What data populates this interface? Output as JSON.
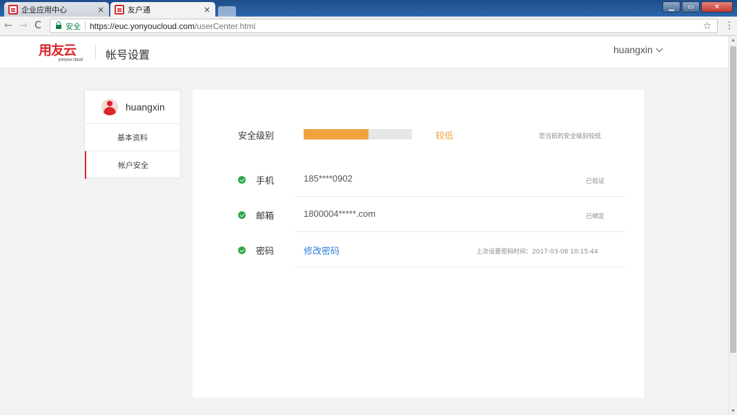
{
  "browser": {
    "tabs": [
      {
        "title": "企业应用中心",
        "close": "×"
      },
      {
        "title": "友户通",
        "close": "×"
      }
    ],
    "window_controls": [
      "▁",
      "▭",
      "✕"
    ],
    "nav": {
      "back": "←",
      "forward": "→",
      "reload": "C"
    },
    "address": {
      "secure_label": "安全",
      "host": "https://euc.yonyoucloud.com",
      "path": "/userCenter.html"
    },
    "star": "☆",
    "menu": "⋮"
  },
  "header": {
    "logo_text": "用友云",
    "logo_sub": "yonyou cloud",
    "title": "帐号设置",
    "username": "huangxin"
  },
  "sidebar": {
    "profile_name": "huangxin",
    "items": [
      {
        "label": "基本资料"
      },
      {
        "label": "帐户安全"
      }
    ]
  },
  "security": {
    "level_label": "安全级别",
    "level_value": "较低",
    "level_fraction": 0.6,
    "level_hint": "您当前的安全级别较低",
    "rows": [
      {
        "label": "手机",
        "value": "185****0902",
        "status": "已验证"
      },
      {
        "label": "邮箱",
        "value": "1800004*****.com",
        "status": "已绑定"
      },
      {
        "label": "密码",
        "link": "修改密码",
        "status": "上次设置密码时间：2017-03-08 10:15:44"
      }
    ]
  },
  "colors": {
    "brand": "#d9262b",
    "warning": "#f0a33c",
    "ok": "#2aa744",
    "link": "#2f7fd8"
  }
}
